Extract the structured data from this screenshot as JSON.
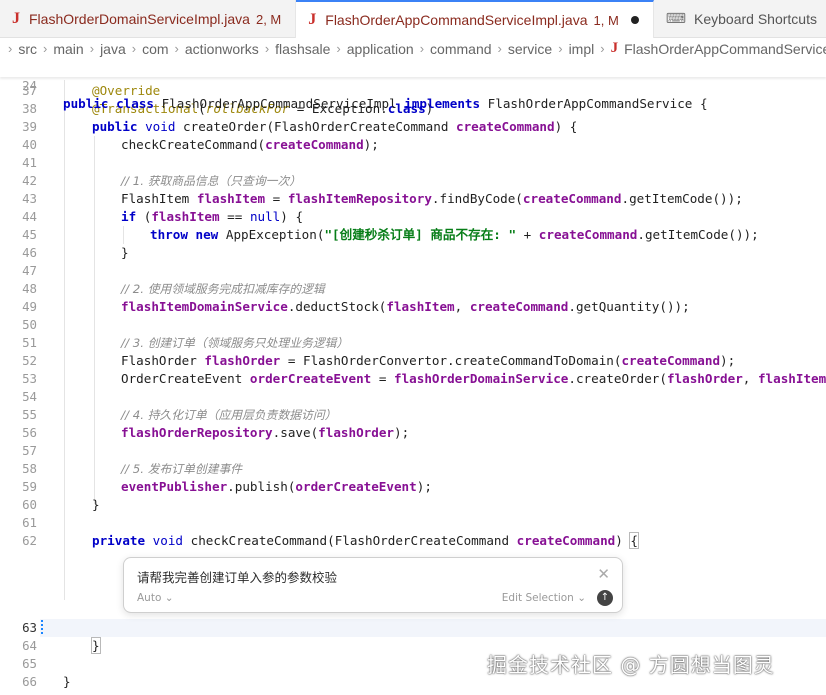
{
  "tabs": [
    {
      "icon": "J",
      "label": "FlashOrderDomainServiceImpl.java",
      "badge": "2, M"
    },
    {
      "icon": "J",
      "label": "FlashOrderAppCommandServiceImpl.java",
      "badge": "1, M"
    },
    {
      "icon": "⌨",
      "label": "Keyboard Shortcuts"
    }
  ],
  "breadcrumb": [
    "src",
    "main",
    "java",
    "com",
    "actionworks",
    "flashsale",
    "application",
    "command",
    "service",
    "impl",
    "FlashOrderAppCommandServiceImpl"
  ],
  "breadcrumb_file_icon": "J",
  "line_numbers": {
    "l24": "24",
    "l37": "37",
    "l38": "38",
    "l39": "39",
    "l40": "40",
    "l41": "41",
    "l42": "42",
    "l43": "43",
    "l44": "44",
    "l45": "45",
    "l46": "46",
    "l47": "47",
    "l48": "48",
    "l49": "49",
    "l50": "50",
    "l51": "51",
    "l52": "52",
    "l53": "53",
    "l54": "54",
    "l55": "55",
    "l56": "56",
    "l57": "57",
    "l58": "58",
    "l59": "59",
    "l60": "60",
    "l61": "61",
    "l62": "62",
    "l63": "63",
    "l64": "64",
    "l65": "65",
    "l66": "66"
  },
  "code": {
    "public": "public",
    "class": "class",
    "implements": "implements",
    "classname": "FlashOrderAppCommandServiceImpl",
    "iface": "FlashOrderAppCommandService",
    "brace_open": "{",
    "brace_close": "}",
    "override": "@Override",
    "transactional": "@Transactional",
    "rollbackFor": "rollbackFor",
    "eq": " = ",
    "exception": "Exception.",
    "class_kw": "class",
    "void": "void",
    "createOrder": "createOrder",
    "cmdType": "FlashOrderCreateCommand",
    "createCommand": "createCommand",
    "checkCreateCommand": "checkCreateCommand",
    "c1": "// 1. 获取商品信息（只查询一次）",
    "flashItemType": "FlashItem",
    "flashItem": "flashItem",
    "flashItemRepository": "flashItemRepository",
    "findByCode": ".findByCode(",
    "getItemCode": ".getItemCode()",
    "if": "if",
    "null": "null",
    "eqeq": " == ",
    "throw": "throw",
    "new": "new",
    "appException": "AppException(",
    "msg": "\"[创建秒杀订单] 商品不存在: \"",
    "plus": " + ",
    "c2": "// 2. 使用领域服务完成扣减库存的逻辑",
    "flashItemDomainService": "flashItemDomainService",
    "deductStock": ".deductStock(",
    "getQuantity": ".getQuantity()",
    "c3": "// 3. 创建订单（领域服务只处理业务逻辑）",
    "flashOrderType": "FlashOrder",
    "flashOrder": "flashOrder",
    "convertor": "FlashOrderConvertor.createCommandToDomain(",
    "orderEventType": "OrderCreateEvent",
    "orderCreateEvent": "orderCreateEvent",
    "flashOrderDomainService": "flashOrderDomainService",
    "createOrderCall": ".createOrder(",
    "c4": "// 4. 持久化订单（应用层负责数据访问）",
    "flashOrderRepository": "flashOrderRepository",
    "save": ".save(",
    "c5": "// 5. 发布订单创建事件",
    "eventPublisher": "eventPublisher",
    "publish": ".publish(",
    "private": "private"
  },
  "inline_chat": {
    "prompt": "请帮我完善创建订单入参的参数校验",
    "mode": "Auto",
    "mode_chevron": "⌄",
    "edit_selection": "Edit Selection",
    "edit_chevron": "⌄"
  },
  "watermark": "掘金技术社区 @ 方圆想当图灵",
  "colors": {
    "accent": "#3b82f6",
    "keyword": "#0000c8",
    "field": "#871094",
    "string": "#067d17",
    "comment": "#8c8c8c",
    "error": "#c9302c"
  }
}
